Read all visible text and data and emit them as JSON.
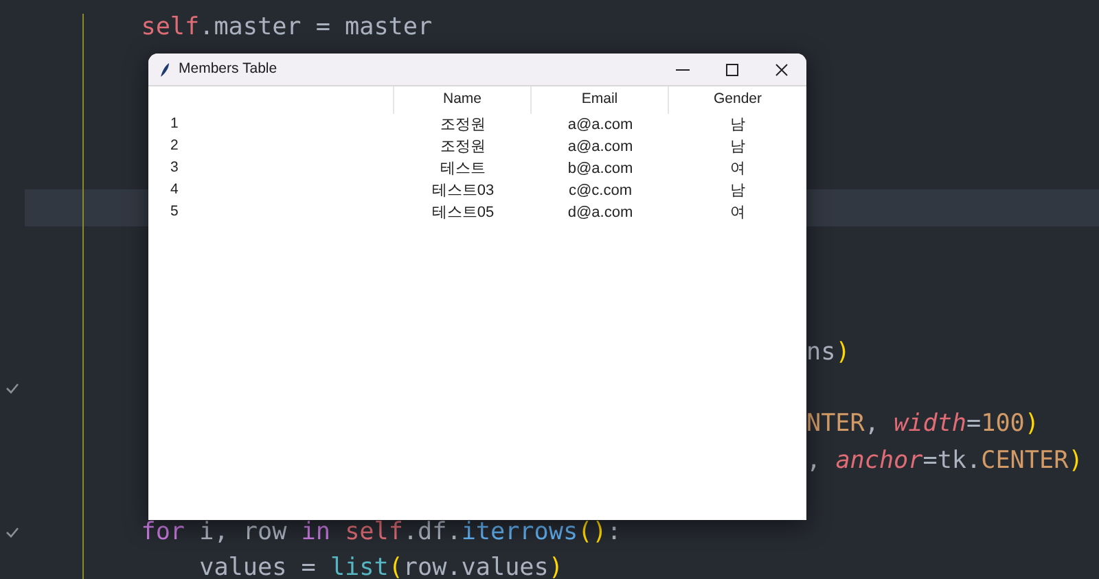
{
  "editor": {
    "lines": [
      {
        "left": [
          {
            "text": "        self",
            "kind": "self"
          },
          {
            "text": ".master = master",
            "kind": "plain"
          }
        ],
        "current": false,
        "check": false
      },
      {
        "current": false,
        "check": false
      },
      {
        "current": false,
        "check": false
      },
      {
        "current": false,
        "check": false
      },
      {
        "current": false,
        "check": false
      },
      {
        "current": true,
        "check": false
      },
      {
        "current": false,
        "check": false
      },
      {
        "current": false,
        "check": false
      },
      {
        "current": false,
        "check": false
      },
      {
        "right": [
          {
            "text": "ns",
            "kind": "plain"
          },
          {
            "text": ")",
            "kind": "paren"
          }
        ],
        "current": false,
        "check": false
      },
      {
        "current": false,
        "check": true
      },
      {
        "right": [
          {
            "text": "NTER",
            "kind": "const"
          },
          {
            "text": ", ",
            "kind": "plain"
          },
          {
            "text": "width",
            "kind": "param"
          },
          {
            "text": "=",
            "kind": "plain"
          },
          {
            "text": "100",
            "kind": "const"
          },
          {
            "text": ")",
            "kind": "paren"
          }
        ],
        "current": false,
        "check": false
      },
      {
        "right": [
          {
            "text": ", ",
            "kind": "plain"
          },
          {
            "text": "anchor",
            "kind": "param"
          },
          {
            "text": "=tk.",
            "kind": "plain"
          },
          {
            "text": "CENTER",
            "kind": "const"
          },
          {
            "text": ")",
            "kind": "paren"
          }
        ],
        "current": false,
        "check": false
      },
      {
        "current": false,
        "check": false
      },
      {
        "left": [
          {
            "text": "        for",
            "kind": "keyword"
          },
          {
            "text": " i, row ",
            "kind": "plain"
          },
          {
            "text": "in ",
            "kind": "keyword"
          },
          {
            "text": "self",
            "kind": "self"
          },
          {
            "text": ".df.",
            "kind": "plain"
          },
          {
            "text": "iterrows",
            "kind": "func"
          },
          {
            "text": "()",
            "kind": "paren"
          },
          {
            "text": ":",
            "kind": "plain"
          }
        ],
        "current": false,
        "check": true
      },
      {
        "left": [
          {
            "text": "            values = ",
            "kind": "plain"
          },
          {
            "text": "list",
            "kind": "builtin"
          },
          {
            "text": "(",
            "kind": "paren"
          },
          {
            "text": "row.values",
            "kind": "plain"
          },
          {
            "text": ")",
            "kind": "paren"
          }
        ],
        "current": false,
        "check": false
      }
    ]
  },
  "window": {
    "title": "Members Table",
    "table": {
      "columns": [
        "Name",
        "Email",
        "Gender"
      ],
      "rows": [
        {
          "index": "1",
          "cells": [
            "조정원",
            "a@a.com",
            "남"
          ]
        },
        {
          "index": "2",
          "cells": [
            "조정원",
            "a@a.com",
            "남"
          ]
        },
        {
          "index": "3",
          "cells": [
            "테스트",
            "b@a.com",
            "여"
          ]
        },
        {
          "index": "4",
          "cells": [
            "테스트03",
            "c@c.com",
            "남"
          ]
        },
        {
          "index": "5",
          "cells": [
            "테스트05",
            "d@a.com",
            "여"
          ]
        }
      ]
    }
  }
}
